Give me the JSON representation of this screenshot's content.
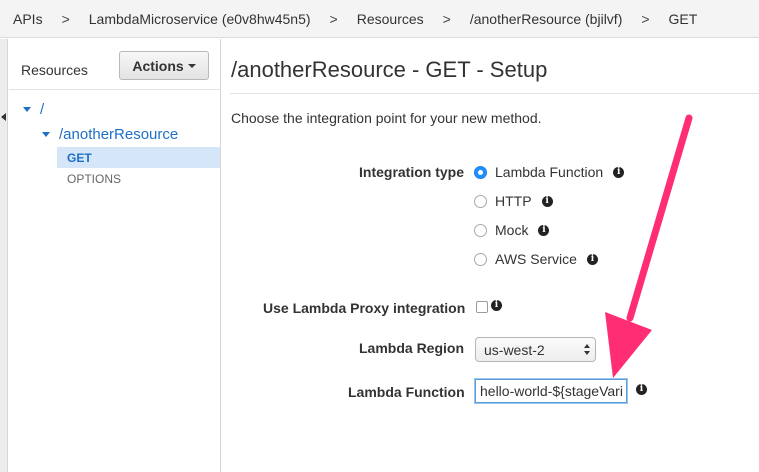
{
  "breadcrumb": {
    "items": [
      "APIs",
      "LambdaMicroservice (e0v8hw45n5)",
      "Resources",
      "/anotherResource (bjilvf)",
      "GET"
    ],
    "separator": ">"
  },
  "sidebar": {
    "title": "Resources",
    "actions_label": "Actions",
    "tree": {
      "root": "/",
      "resource": "/anotherResource",
      "methods": [
        "GET",
        "OPTIONS"
      ],
      "selected_method": "GET"
    }
  },
  "main": {
    "title": "/anotherResource - GET - Setup",
    "intro": "Choose the integration point for your new method.",
    "integration_type": {
      "label": "Integration type",
      "options": [
        "Lambda Function",
        "HTTP",
        "Mock",
        "AWS Service"
      ],
      "selected": "Lambda Function"
    },
    "proxy": {
      "label": "Use Lambda Proxy integration",
      "checked": false
    },
    "region": {
      "label": "Lambda Region",
      "value": "us-west-2"
    },
    "function": {
      "label": "Lambda Function",
      "value": "hello-world-${stageVari"
    }
  },
  "icons": {
    "info": "info-icon",
    "annotation": "arrow-annotation"
  },
  "colors": {
    "link_blue": "#1f6fc5",
    "selected_row": "#d4e6f7",
    "radio_selected": "#1f8fff",
    "annotation_arrow": "#ff2d73"
  }
}
